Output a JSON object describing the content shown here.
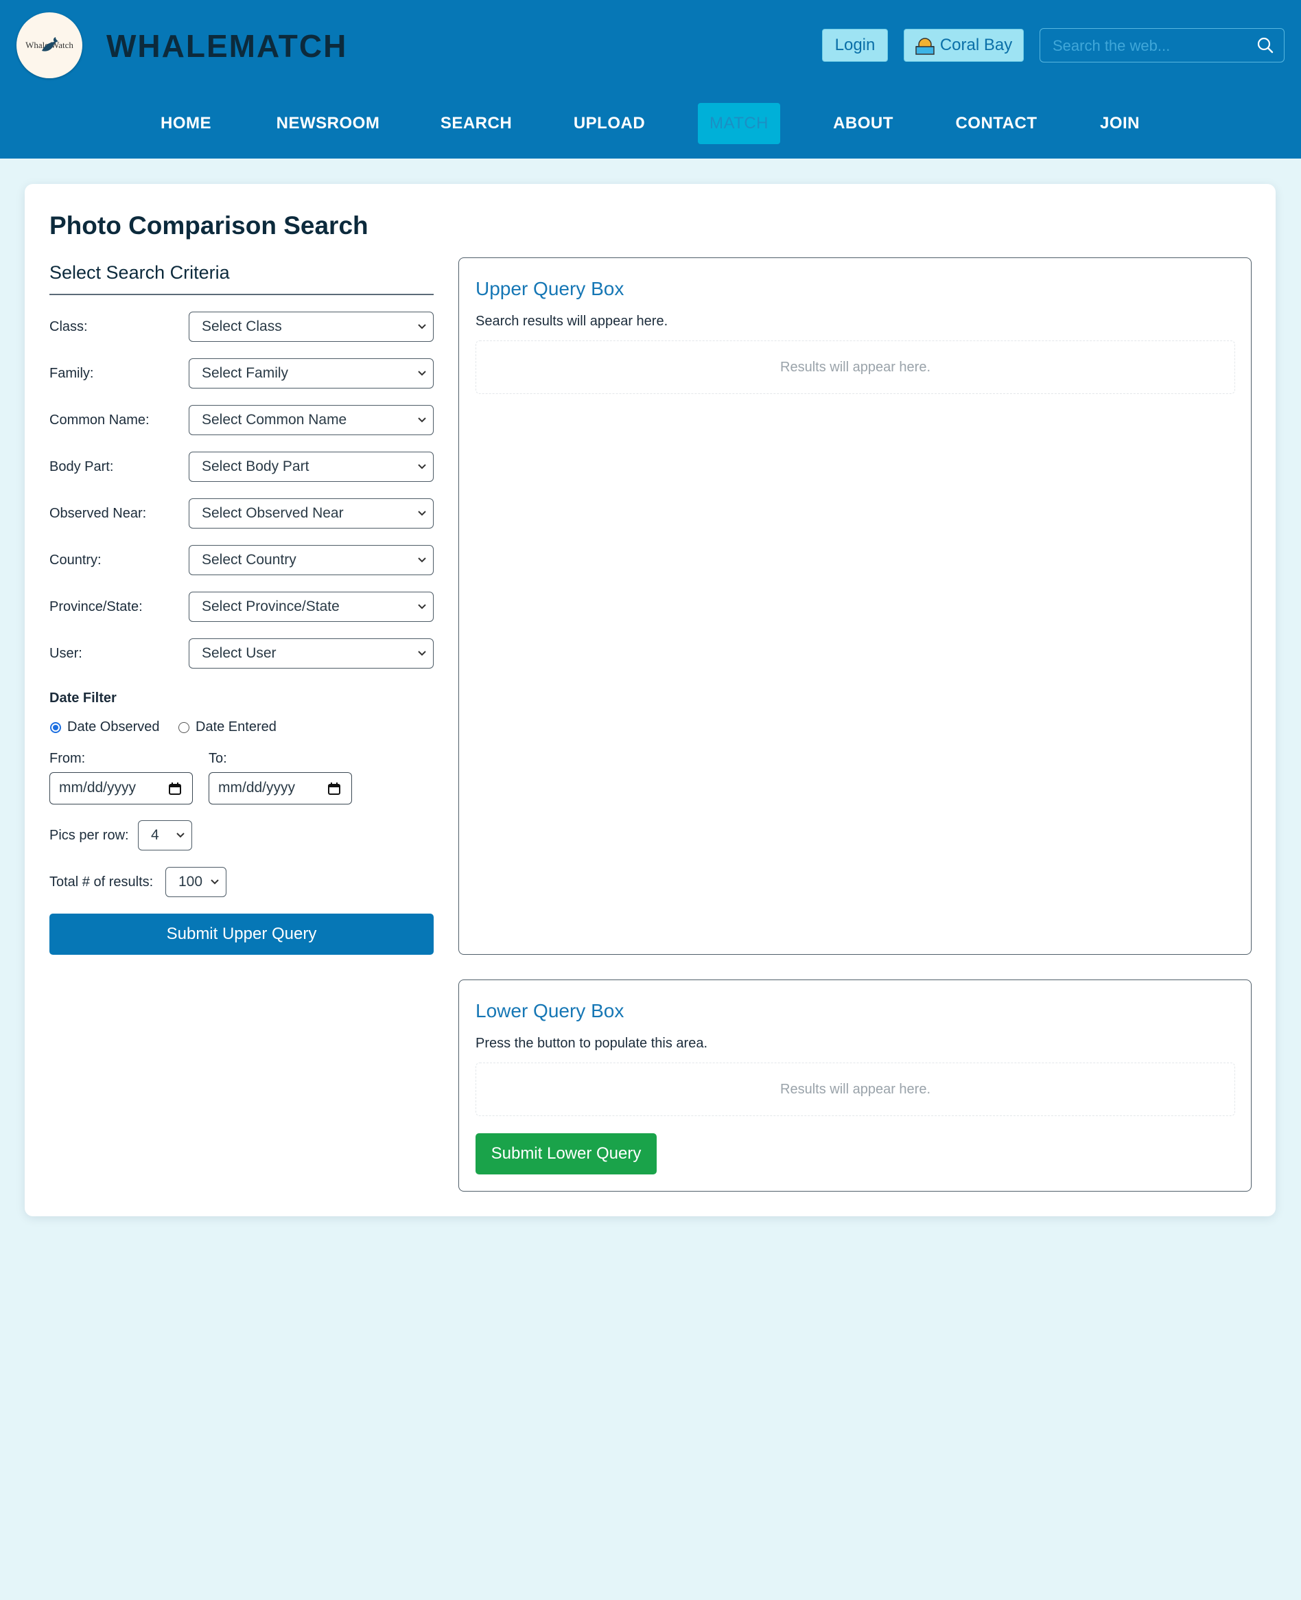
{
  "header": {
    "logo_text": "Whale Watch",
    "brand": "WHALEMATCH",
    "login_label": "Login",
    "user_label": "Coral Bay",
    "search_placeholder": "Search the web..."
  },
  "nav": {
    "items": [
      {
        "label": "HOME"
      },
      {
        "label": "NEWSROOM"
      },
      {
        "label": "SEARCH"
      },
      {
        "label": "UPLOAD"
      },
      {
        "label": "MATCH",
        "active": true
      },
      {
        "label": "ABOUT"
      },
      {
        "label": "CONTACT"
      },
      {
        "label": "JOIN"
      }
    ]
  },
  "page": {
    "title": "Photo Comparison Search",
    "criteria_title": "Select Search Criteria",
    "fields": [
      {
        "label": "Class:",
        "value": "Select Class"
      },
      {
        "label": "Family:",
        "value": "Select Family"
      },
      {
        "label": "Common Name:",
        "value": "Select Common Name"
      },
      {
        "label": "Body Part:",
        "value": "Select Body Part"
      },
      {
        "label": "Observed Near:",
        "value": "Select Observed Near"
      },
      {
        "label": "Country:",
        "value": "Select Country"
      },
      {
        "label": "Province/State:",
        "value": "Select Province/State"
      },
      {
        "label": "User:",
        "value": "Select User"
      }
    ],
    "date_filter": {
      "title": "Date Filter",
      "option_observed": "Date Observed",
      "option_entered": "Date Entered",
      "selected": "Date Observed",
      "from_label": "From:",
      "to_label": "To:",
      "from_value": "mm/dd/yyyy",
      "to_value": "mm/dd/yyyy"
    },
    "pics_per_row": {
      "label": "Pics per row:",
      "value": "4"
    },
    "total_results": {
      "label": "Total # of results:",
      "value": "100"
    },
    "submit_upper_label": "Submit Upper Query"
  },
  "upper_box": {
    "title": "Upper Query Box",
    "description": "Search results will appear here.",
    "placeholder": "Results will appear here."
  },
  "lower_box": {
    "title": "Lower Query Box",
    "description": "Press the button to populate this area.",
    "placeholder": "Results will appear here.",
    "submit_label": "Submit Lower Query"
  },
  "colors": {
    "header_bg": "#0677b6",
    "page_bg": "#e4f5f9",
    "nav_active_bg": "#00b0d8",
    "primary_button": "#0677b6",
    "secondary_button": "#1aa34a",
    "box_title": "#1677b5"
  },
  "icons": {
    "logo": "whale-logo-icon",
    "user": "sun-avatar-icon",
    "search": "search-icon",
    "select": "chevron-down-icon",
    "date": "calendar-icon"
  }
}
